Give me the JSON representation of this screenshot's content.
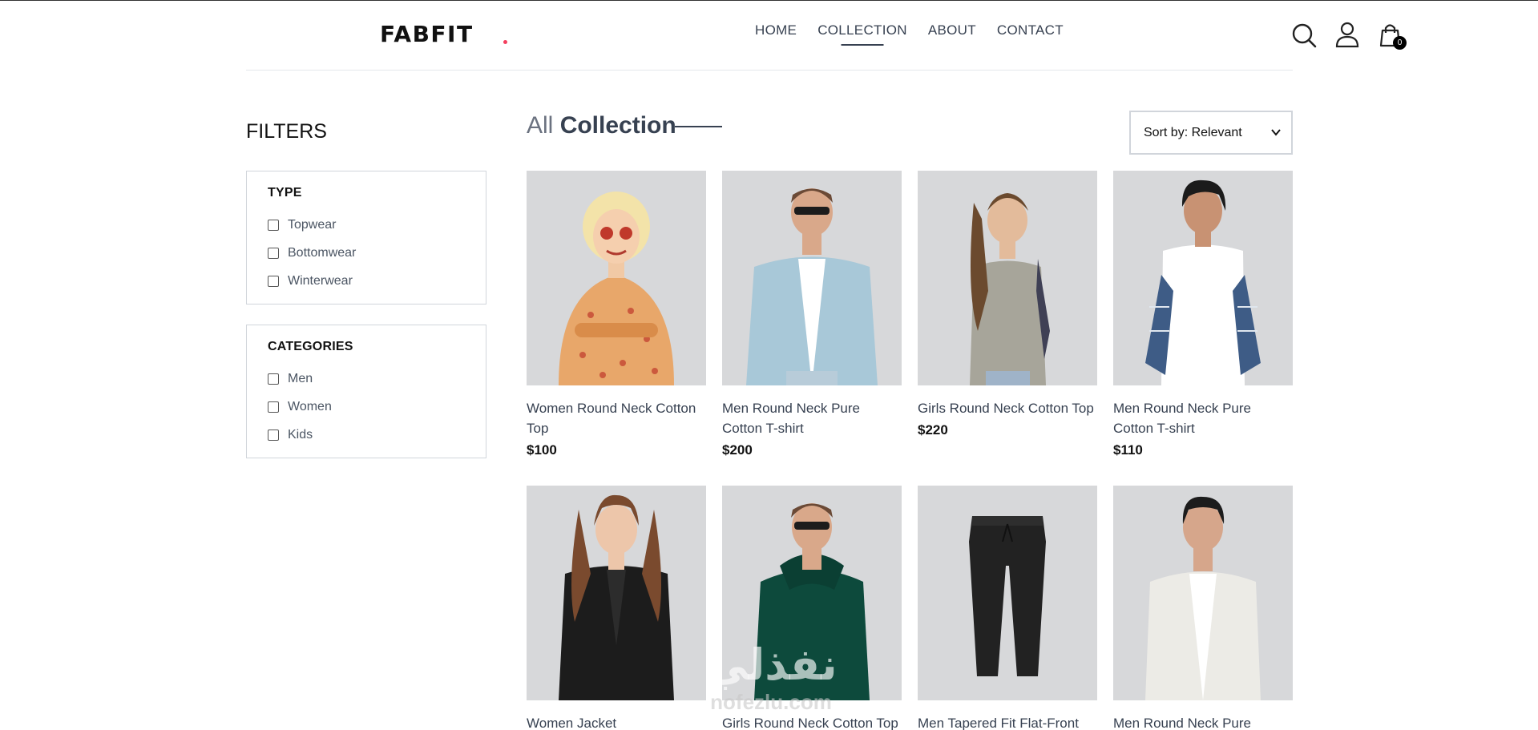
{
  "brand": {
    "name": "FABFIT",
    "accent": "#f43f5e"
  },
  "nav": {
    "items": [
      "HOME",
      "COLLECTION",
      "ABOUT",
      "CONTACT"
    ],
    "active": "COLLECTION",
    "icons": [
      "search-icon",
      "user-icon",
      "cart-icon"
    ],
    "cart_count": "0"
  },
  "filters": {
    "title": "FILTERS",
    "type": {
      "heading": "TYPE",
      "options": [
        "Topwear",
        "Bottomwear",
        "Winterwear"
      ]
    },
    "categories": {
      "heading": "CATEGORIES",
      "options": [
        "Men",
        "Women",
        "Kids"
      ]
    }
  },
  "collection": {
    "title_light": "All",
    "title_bold": "Collection",
    "sort": "Sort by: Relevant"
  },
  "products": [
    {
      "name": "Women Round Neck Cotton Top",
      "price": "$100",
      "image": "woman-patterned-blouse"
    },
    {
      "name": "Men Round Neck Pure Cotton T-shirt",
      "price": "$200",
      "image": "man-denim-jacket"
    },
    {
      "name": "Girls Round Neck Cotton Top",
      "price": "$220",
      "image": "girl-grey-top"
    },
    {
      "name": "Men Round Neck Pure Cotton T-shirt",
      "price": "$110",
      "image": "man-white-tee-plaid"
    },
    {
      "name": "Women Jacket",
      "price": "",
      "image": "woman-leather-jacket"
    },
    {
      "name": "Girls Round Neck Cotton Top",
      "price": "",
      "image": "man-green-hoodie"
    },
    {
      "name": "Men Tapered Fit Flat-Front",
      "price": "",
      "image": "black-joggers"
    },
    {
      "name": "Men Round Neck Pure",
      "price": "",
      "image": "man-white-denim-jacket"
    }
  ],
  "watermark": {
    "line1": "نفذلي",
    "line2": "nofezlu.com"
  }
}
